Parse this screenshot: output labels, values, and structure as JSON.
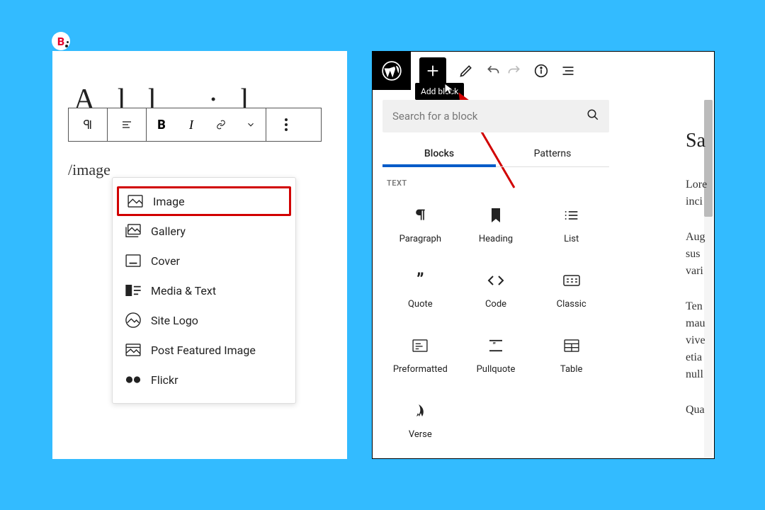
{
  "logo": {
    "letter": "B"
  },
  "left": {
    "title_placeholder": "A   l   l      •   l",
    "slash": "/image",
    "items": [
      {
        "label": "Image",
        "highlight": true,
        "icon": "image-icon"
      },
      {
        "label": "Gallery",
        "highlight": false,
        "icon": "gallery-icon"
      },
      {
        "label": "Cover",
        "highlight": false,
        "icon": "cover-icon"
      },
      {
        "label": "Media & Text",
        "highlight": false,
        "icon": "media-text-icon"
      },
      {
        "label": "Site Logo",
        "highlight": false,
        "icon": "site-logo-icon"
      },
      {
        "label": "Post Featured Image",
        "highlight": false,
        "icon": "featured-image-icon"
      },
      {
        "label": "Flickr",
        "highlight": false,
        "icon": "flickr-icon"
      }
    ]
  },
  "right": {
    "tooltip": "Add block",
    "search_placeholder": "Search for a block",
    "tabs": {
      "active": "Blocks",
      "other": "Patterns"
    },
    "section": "TEXT",
    "blocks": [
      {
        "label": "Paragraph",
        "icon": "paragraph-icon"
      },
      {
        "label": "Heading",
        "icon": "bookmark-icon"
      },
      {
        "label": "List",
        "icon": "list-icon"
      },
      {
        "label": "Quote",
        "icon": "quote-icon"
      },
      {
        "label": "Code",
        "icon": "code-icon"
      },
      {
        "label": "Classic",
        "icon": "classic-icon"
      },
      {
        "label": "Preformatted",
        "icon": "preformatted-icon"
      },
      {
        "label": "Pullquote",
        "icon": "pullquote-icon"
      },
      {
        "label": "Table",
        "icon": "table-icon"
      },
      {
        "label": "Verse",
        "icon": "verse-icon"
      }
    ],
    "preview": {
      "title": "Sa",
      "p1": "Lore\ninci",
      "p2": "Aug\nsus\nvari",
      "p3": "Ten\nmau\nvive\netia\nnull",
      "p4": "Qua"
    }
  }
}
